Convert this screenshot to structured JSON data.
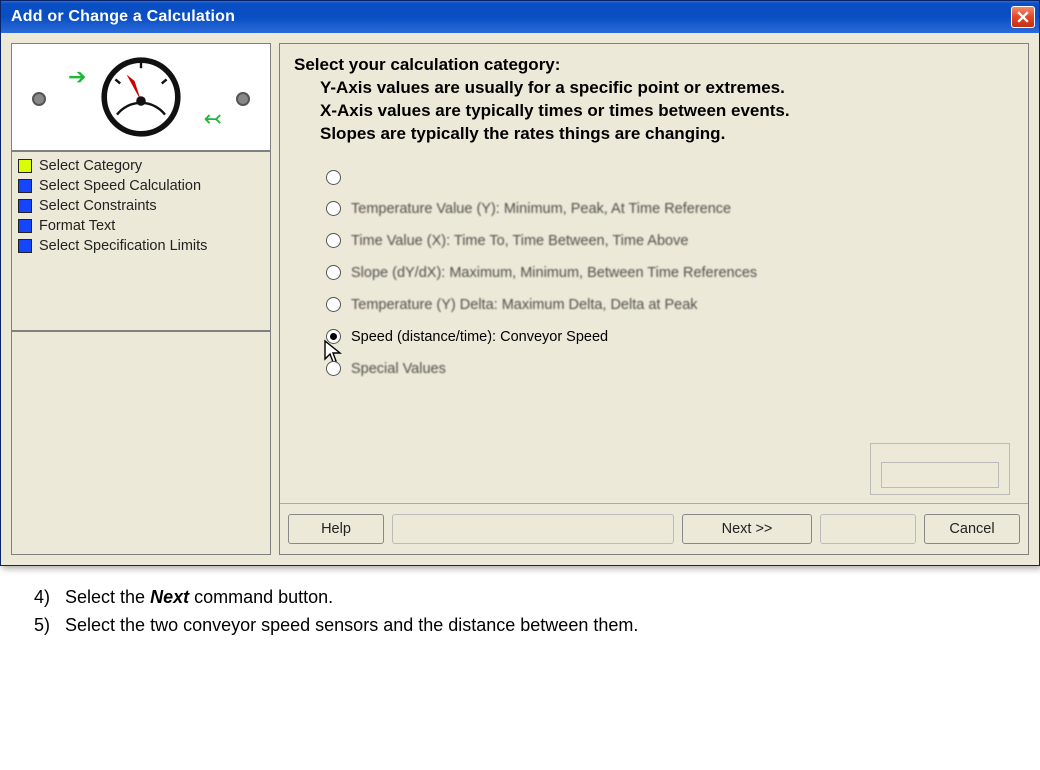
{
  "window": {
    "title": "Add or Change a Calculation"
  },
  "steps": [
    {
      "color": "yellow",
      "label": "Select Category"
    },
    {
      "color": "blue",
      "label": "Select Speed Calculation"
    },
    {
      "color": "blue",
      "label": "Select Constraints"
    },
    {
      "color": "blue",
      "label": "Format Text"
    },
    {
      "color": "blue",
      "label": "Select Specification Limits"
    }
  ],
  "heading": {
    "line1": "Select your calculation category:",
    "line2": "Y-Axis values are usually for a specific point or extremes.",
    "line3": "X-Axis values are typically times or times between events.",
    "line4": "Slopes are typically the rates things are changing."
  },
  "options": [
    {
      "label": "",
      "selected": false,
      "dim": true
    },
    {
      "label": "Temperature Value (Y):  Minimum, Peak, At Time Reference",
      "selected": false
    },
    {
      "label": "Time Value (X):  Time To, Time Between, Time Above",
      "selected": false
    },
    {
      "label": "Slope (dY/dX):  Maximum, Minimum, Between Time References",
      "selected": false
    },
    {
      "label": "Temperature (Y) Delta:  Maximum Delta, Delta at Peak",
      "selected": false
    },
    {
      "label": "Speed (distance/time): Conveyor Speed",
      "selected": true
    },
    {
      "label": "Special  Values",
      "selected": false
    }
  ],
  "buttons": {
    "help": "Help",
    "back": "",
    "next": "Next >>",
    "finish": "",
    "cancel": "Cancel"
  },
  "instructions": {
    "step4_num": "4)",
    "step4_a": "Select the ",
    "step4_b": "Next",
    "step4_c": " command button.",
    "step5_num": "5)",
    "step5": "Select the two conveyor speed sensors and the distance between them."
  }
}
